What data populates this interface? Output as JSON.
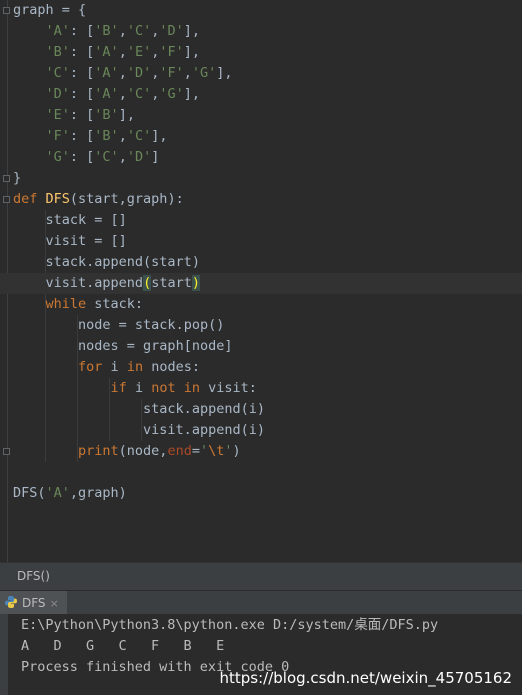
{
  "editor": {
    "lines": [
      {
        "indent": "",
        "tokens": [
          {
            "t": "graph = {",
            "c": "txt"
          }
        ]
      },
      {
        "indent": "    ",
        "tokens": [
          {
            "t": "'A'",
            "c": "str"
          },
          {
            "t": ": [",
            "c": "txt"
          },
          {
            "t": "'B'",
            "c": "str"
          },
          {
            "t": ",",
            "c": "txt"
          },
          {
            "t": "'C'",
            "c": "str"
          },
          {
            "t": ",",
            "c": "txt"
          },
          {
            "t": "'D'",
            "c": "str"
          },
          {
            "t": "],",
            "c": "txt"
          }
        ]
      },
      {
        "indent": "    ",
        "tokens": [
          {
            "t": "'B'",
            "c": "str"
          },
          {
            "t": ": [",
            "c": "txt"
          },
          {
            "t": "'A'",
            "c": "str"
          },
          {
            "t": ",",
            "c": "txt"
          },
          {
            "t": "'E'",
            "c": "str"
          },
          {
            "t": ",",
            "c": "txt"
          },
          {
            "t": "'F'",
            "c": "str"
          },
          {
            "t": "],",
            "c": "txt"
          }
        ]
      },
      {
        "indent": "    ",
        "tokens": [
          {
            "t": "'C'",
            "c": "str"
          },
          {
            "t": ": [",
            "c": "txt"
          },
          {
            "t": "'A'",
            "c": "str"
          },
          {
            "t": ",",
            "c": "txt"
          },
          {
            "t": "'D'",
            "c": "str"
          },
          {
            "t": ",",
            "c": "txt"
          },
          {
            "t": "'F'",
            "c": "str"
          },
          {
            "t": ",",
            "c": "txt"
          },
          {
            "t": "'G'",
            "c": "str"
          },
          {
            "t": "],",
            "c": "txt"
          }
        ]
      },
      {
        "indent": "    ",
        "tokens": [
          {
            "t": "'D'",
            "c": "str"
          },
          {
            "t": ": [",
            "c": "txt"
          },
          {
            "t": "'A'",
            "c": "str"
          },
          {
            "t": ",",
            "c": "txt"
          },
          {
            "t": "'C'",
            "c": "str"
          },
          {
            "t": ",",
            "c": "txt"
          },
          {
            "t": "'G'",
            "c": "str"
          },
          {
            "t": "],",
            "c": "txt"
          }
        ]
      },
      {
        "indent": "    ",
        "tokens": [
          {
            "t": "'E'",
            "c": "str"
          },
          {
            "t": ": [",
            "c": "txt"
          },
          {
            "t": "'B'",
            "c": "str"
          },
          {
            "t": "],",
            "c": "txt"
          }
        ]
      },
      {
        "indent": "    ",
        "tokens": [
          {
            "t": "'F'",
            "c": "str"
          },
          {
            "t": ": [",
            "c": "txt"
          },
          {
            "t": "'B'",
            "c": "str"
          },
          {
            "t": ",",
            "c": "txt"
          },
          {
            "t": "'C'",
            "c": "str"
          },
          {
            "t": "],",
            "c": "txt"
          }
        ]
      },
      {
        "indent": "    ",
        "tokens": [
          {
            "t": "'G'",
            "c": "str"
          },
          {
            "t": ": [",
            "c": "txt"
          },
          {
            "t": "'C'",
            "c": "str"
          },
          {
            "t": ",",
            "c": "txt"
          },
          {
            "t": "'D'",
            "c": "str"
          },
          {
            "t": "]",
            "c": "txt"
          }
        ]
      },
      {
        "indent": "",
        "tokens": [
          {
            "t": "}",
            "c": "txt"
          }
        ]
      },
      {
        "indent": "",
        "tokens": [
          {
            "t": "def ",
            "c": "kw"
          },
          {
            "t": "DFS",
            "c": "fn"
          },
          {
            "t": "(start,graph):",
            "c": "txt"
          }
        ]
      },
      {
        "indent": "    ",
        "tokens": [
          {
            "t": "stack = []",
            "c": "txt"
          }
        ]
      },
      {
        "indent": "    ",
        "tokens": [
          {
            "t": "visit = []",
            "c": "txt"
          }
        ]
      },
      {
        "indent": "    ",
        "tokens": [
          {
            "t": "stack.append(start)",
            "c": "txt"
          }
        ]
      },
      {
        "indent": "    ",
        "tokens": [
          {
            "t": "visit.append",
            "c": "txt"
          },
          {
            "t": "(",
            "c": "hl"
          },
          {
            "t": "start",
            "c": "txt"
          },
          {
            "t": ")",
            "c": "hl"
          }
        ]
      },
      {
        "indent": "    ",
        "tokens": [
          {
            "t": "while ",
            "c": "kw"
          },
          {
            "t": "stack:",
            "c": "txt"
          }
        ]
      },
      {
        "indent": "        ",
        "tokens": [
          {
            "t": "node = stack.pop()",
            "c": "txt"
          }
        ]
      },
      {
        "indent": "        ",
        "tokens": [
          {
            "t": "nodes = graph[node]",
            "c": "txt"
          }
        ]
      },
      {
        "indent": "        ",
        "tokens": [
          {
            "t": "for ",
            "c": "kw"
          },
          {
            "t": "i ",
            "c": "txt"
          },
          {
            "t": "in ",
            "c": "kw"
          },
          {
            "t": "nodes:",
            "c": "txt"
          }
        ]
      },
      {
        "indent": "            ",
        "tokens": [
          {
            "t": "if ",
            "c": "kw"
          },
          {
            "t": "i ",
            "c": "txt"
          },
          {
            "t": "not in ",
            "c": "kw"
          },
          {
            "t": "visit:",
            "c": "txt"
          }
        ]
      },
      {
        "indent": "                ",
        "tokens": [
          {
            "t": "stack.append(i)",
            "c": "txt"
          }
        ]
      },
      {
        "indent": "                ",
        "tokens": [
          {
            "t": "visit.append(i)",
            "c": "txt"
          }
        ]
      },
      {
        "indent": "        ",
        "tokens": [
          {
            "t": "print",
            "c": "kw"
          },
          {
            "t": "(node,",
            "c": "txt"
          },
          {
            "t": "end",
            "c": "par"
          },
          {
            "t": "=",
            "c": "txt"
          },
          {
            "t": "'",
            "c": "str"
          },
          {
            "t": "\\t",
            "c": "esc"
          },
          {
            "t": "'",
            "c": "str"
          },
          {
            "t": ")",
            "c": "txt"
          }
        ]
      },
      {
        "indent": "",
        "tokens": []
      },
      {
        "indent": "",
        "tokens": [
          {
            "t": "DFS(",
            "c": "txt"
          },
          {
            "t": "'A'",
            "c": "str"
          },
          {
            "t": ",graph)",
            "c": "txt"
          }
        ]
      }
    ]
  },
  "breadcrumb": "DFS()",
  "run_tab": {
    "label": "DFS",
    "close": "×"
  },
  "console": {
    "command": "E:\\Python\\Python3.8\\python.exe D:/system/桌面/DFS.py",
    "output": "A   D   G   C   F   B   E",
    "exit": "Process finished with exit code 0"
  },
  "watermark": "https://blog.csdn.net/weixin_45705162",
  "colors": {
    "keyword": "#cc7832",
    "string": "#6a8759",
    "function": "#ffc66d",
    "param": "#aa4926",
    "text": "#a9b7c6",
    "background": "#2b2b2b"
  }
}
